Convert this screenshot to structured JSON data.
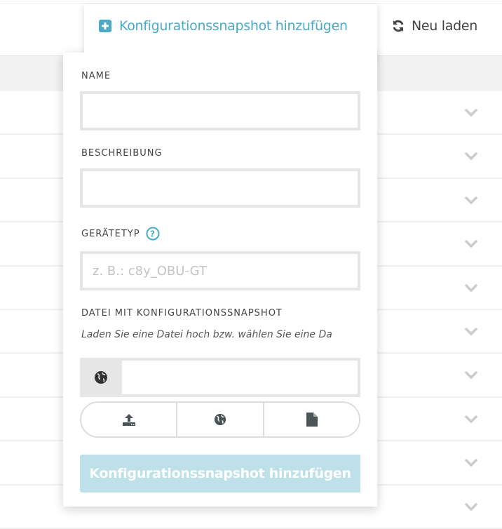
{
  "toolbar": {
    "add_snapshot_label": "Konfigurationssnapshot hinzufügen",
    "reload_label": "Neu laden",
    "accent_color": "#4aaac8"
  },
  "form": {
    "name_label": "NAME",
    "name_value": "",
    "description_label": "BESCHREIBUNG",
    "description_value": "",
    "device_type_label": "GERÄTETYP",
    "device_type_placeholder": "z. B.: c8y_OBU-GT",
    "file_label": "DATEI MIT KONFIGURATIONSSNAPSHOT",
    "file_hint": "Laden Sie eine Datei hoch bzw. wählen Sie eine Da",
    "url_value": "",
    "source_options": [
      "upload-icon",
      "globe-icon",
      "file-icon"
    ],
    "submit_label": "Konfigurationssnapshot hinzufügen",
    "submit_color": "#bde0e9"
  }
}
